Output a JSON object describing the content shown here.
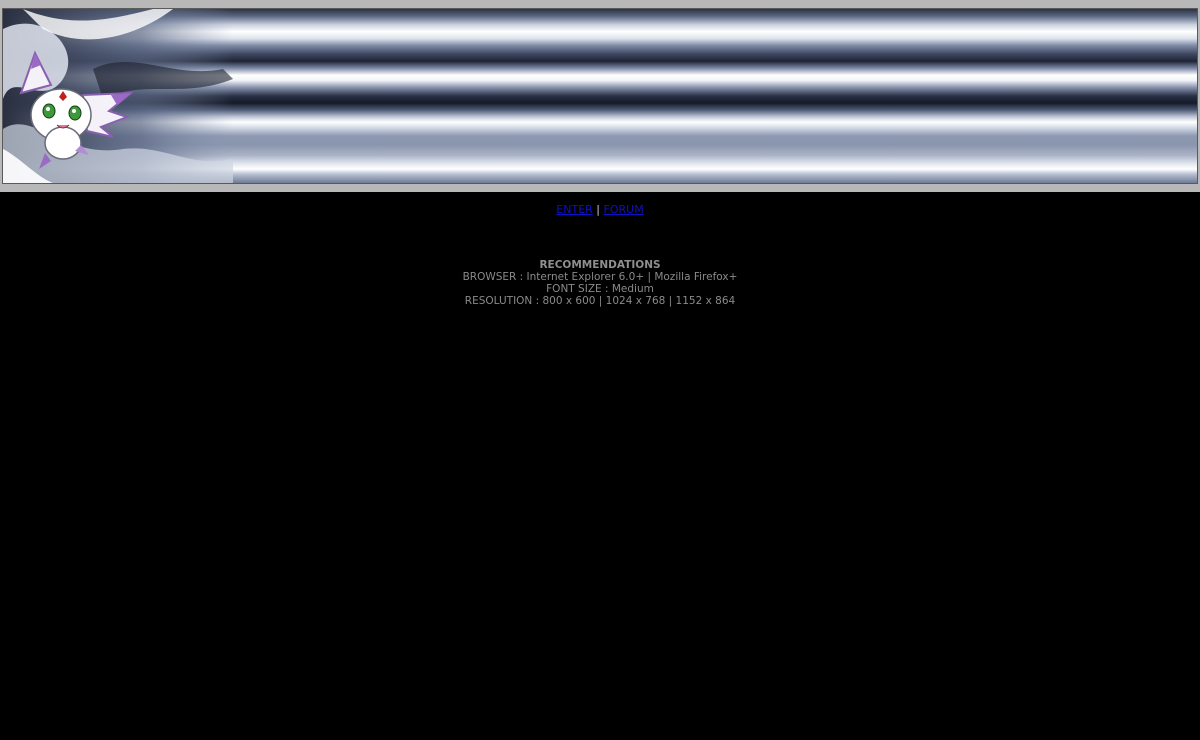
{
  "nav": {
    "enter_label": "ENTER",
    "separator": "|",
    "forum_label": "FORUM"
  },
  "recommendations": {
    "title": "RECOMMENDATIONS",
    "browser": "BROWSER : Internet Explorer 6.0+ | Mozilla Firefox+",
    "font_size": "FONT SIZE : Medium",
    "resolution": "RESOLUTION : 800 x 600 | 1024 x 768 | 1152 x 864"
  },
  "colors": {
    "background": "#000000",
    "link": "#1010c8",
    "text": "#8a8a8a"
  }
}
